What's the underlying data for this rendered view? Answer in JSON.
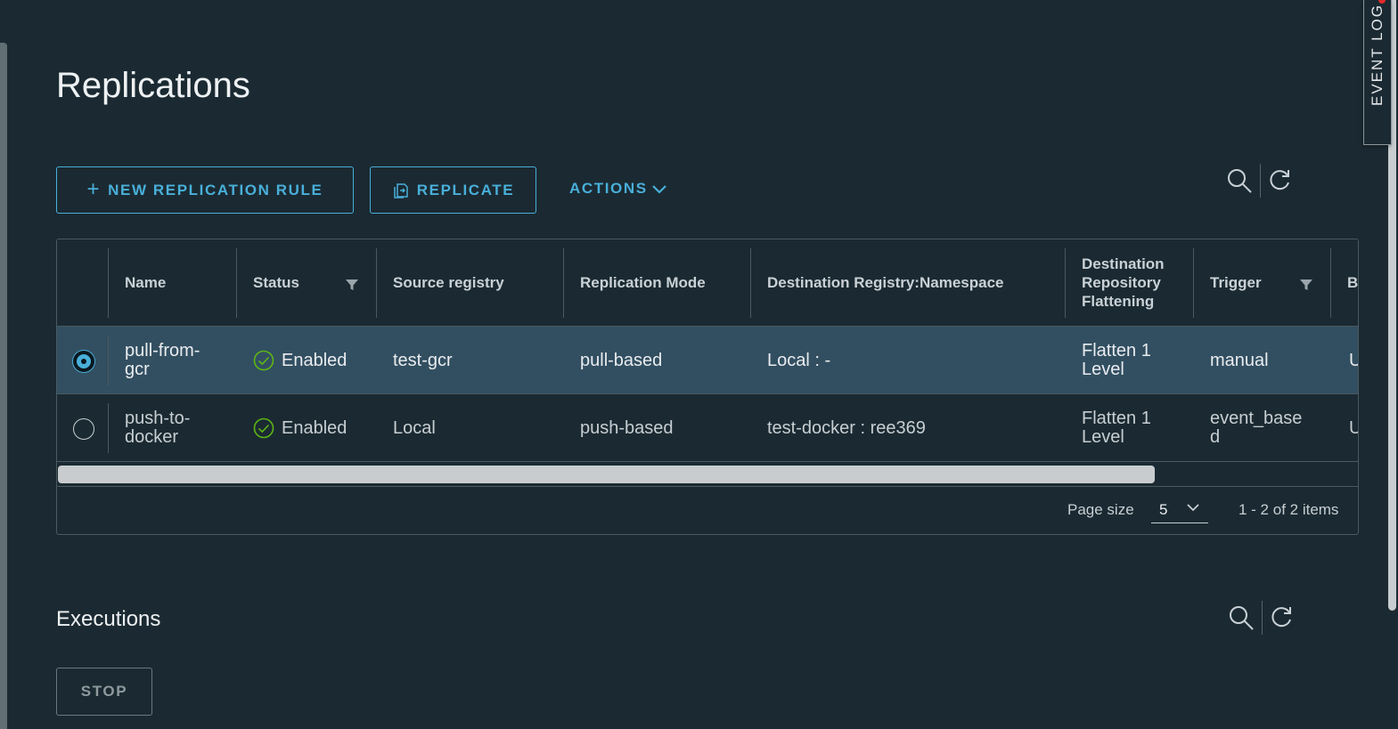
{
  "event_log": {
    "label": "EVENT LOG"
  },
  "page_title": "Replications",
  "toolbar": {
    "new_rule_label": "NEW REPLICATION RULE",
    "replicate_label": "REPLICATE",
    "actions_label": "ACTIONS",
    "icons": [
      "search-icon",
      "refresh-icon"
    ]
  },
  "table": {
    "columns": [
      "Name",
      "Status",
      "Source registry",
      "Replication Mode",
      "Destination Registry:Namespace",
      "Destination Repository Flattening",
      "Trigger",
      "B"
    ],
    "rows": [
      {
        "selected": true,
        "name": "pull-from-gcr",
        "status": "Enabled",
        "source": "test-gcr",
        "mode": "pull-based",
        "destination": "Local : -",
        "flattening": "Flatten 1 Level",
        "trigger": "manual",
        "extra": "U"
      },
      {
        "selected": false,
        "name": "push-to-docker",
        "status": "Enabled",
        "source": "Local",
        "mode": "push-based",
        "destination": "test-docker : ree369",
        "flattening": "Flatten 1 Level",
        "trigger": "event_based",
        "extra": "U"
      }
    ],
    "footer": {
      "page_size_label": "Page size",
      "page_size_value": "5",
      "items_count": "1 - 2 of 2 items"
    }
  },
  "executions": {
    "title": "Executions",
    "stop_label": "STOP"
  },
  "colors": {
    "background": "#1b2a32",
    "accent": "#49afd9",
    "selected_row": "#324f61",
    "success": "#5eb715"
  }
}
